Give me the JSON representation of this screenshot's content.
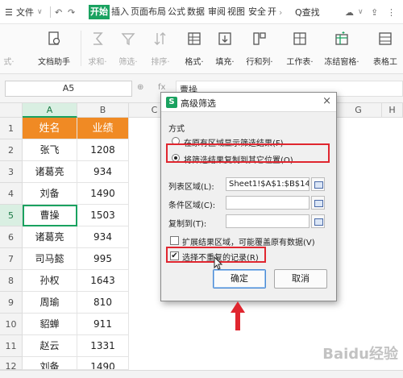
{
  "menubar": {
    "file_label": "文件",
    "tabs": [
      {
        "label": "开始",
        "active": true
      },
      {
        "label": "插入",
        "active": false
      },
      {
        "label": "页面布局",
        "active": false
      },
      {
        "label": "公式",
        "active": false
      },
      {
        "label": "数据",
        "active": false
      },
      {
        "label": "审阅",
        "active": false
      },
      {
        "label": "视图",
        "active": false
      },
      {
        "label": "安全",
        "active": false
      },
      {
        "label": "开",
        "active": false
      }
    ],
    "search_label": "Q查找"
  },
  "ribbon": {
    "buttons": [
      {
        "label": "式·",
        "icon": "format-painter-icon",
        "disabled": true
      },
      {
        "label": "文档助手",
        "icon": "document-assistant-icon",
        "disabled": false
      },
      {
        "label": "求和·",
        "icon": "sum-icon",
        "disabled": true
      },
      {
        "label": "筛选·",
        "icon": "filter-icon",
        "disabled": true
      },
      {
        "label": "排序·",
        "icon": "sort-icon",
        "disabled": true
      },
      {
        "label": "格式·",
        "icon": "format-icon",
        "disabled": false
      },
      {
        "label": "填充·",
        "icon": "fill-icon",
        "disabled": false
      },
      {
        "label": "行和列·",
        "icon": "rows-columns-icon",
        "disabled": false
      },
      {
        "label": "工作表·",
        "icon": "worksheet-icon",
        "disabled": false
      },
      {
        "label": "冻结窗格·",
        "icon": "freeze-panes-icon",
        "disabled": false
      },
      {
        "label": "表格工",
        "icon": "table-tools-icon",
        "disabled": false
      }
    ]
  },
  "formula_bar": {
    "name_box": "A5",
    "formula_value": "曹操"
  },
  "grid": {
    "columns": [
      "A",
      "B",
      "C",
      "D",
      "E",
      "F",
      "G",
      "H"
    ],
    "row_numbers": [
      "1",
      "2",
      "3",
      "4",
      "5",
      "6",
      "7",
      "8",
      "9",
      "10",
      "11",
      "12"
    ],
    "header": {
      "a": "姓名",
      "b": "业绩"
    },
    "rows": [
      {
        "a": "张飞",
        "b": "1208"
      },
      {
        "a": "诸葛亮",
        "b": "934"
      },
      {
        "a": "刘备",
        "b": "1490"
      },
      {
        "a": "曹操",
        "b": "1503"
      },
      {
        "a": "诸葛亮",
        "b": "934"
      },
      {
        "a": "司马懿",
        "b": "995"
      },
      {
        "a": "孙权",
        "b": "1643"
      },
      {
        "a": "周瑜",
        "b": "810"
      },
      {
        "a": "貂蝉",
        "b": "911"
      },
      {
        "a": "赵云",
        "b": "1331"
      },
      {
        "a": "刘备",
        "b": "1490"
      }
    ],
    "header_color": "#f08a24",
    "accent_color": "#1aa260"
  },
  "dialog": {
    "title": "高级筛选",
    "close_glyph": "×",
    "section_label": "方式",
    "option_in_place": "在原有区域显示筛选结果(F)",
    "option_copy": "将筛选结果复制到其它位置(O)",
    "list_range_label": "列表区域(L):",
    "list_range_value": "Sheet1!$A$1:$B$14",
    "criteria_label": "条件区域(C):",
    "criteria_value": "",
    "copy_to_label": "复制到(T):",
    "copy_to_value": "",
    "expand_label": "扩展结果区域，可能覆盖原有数据(V)",
    "unique_label": "选择不重复的记录(R)",
    "unique_checked_glyph": "✔",
    "ok_label": "确定",
    "cancel_label": "取消",
    "highlight_color": "#e0262f"
  },
  "watermark": "Baidu经验"
}
